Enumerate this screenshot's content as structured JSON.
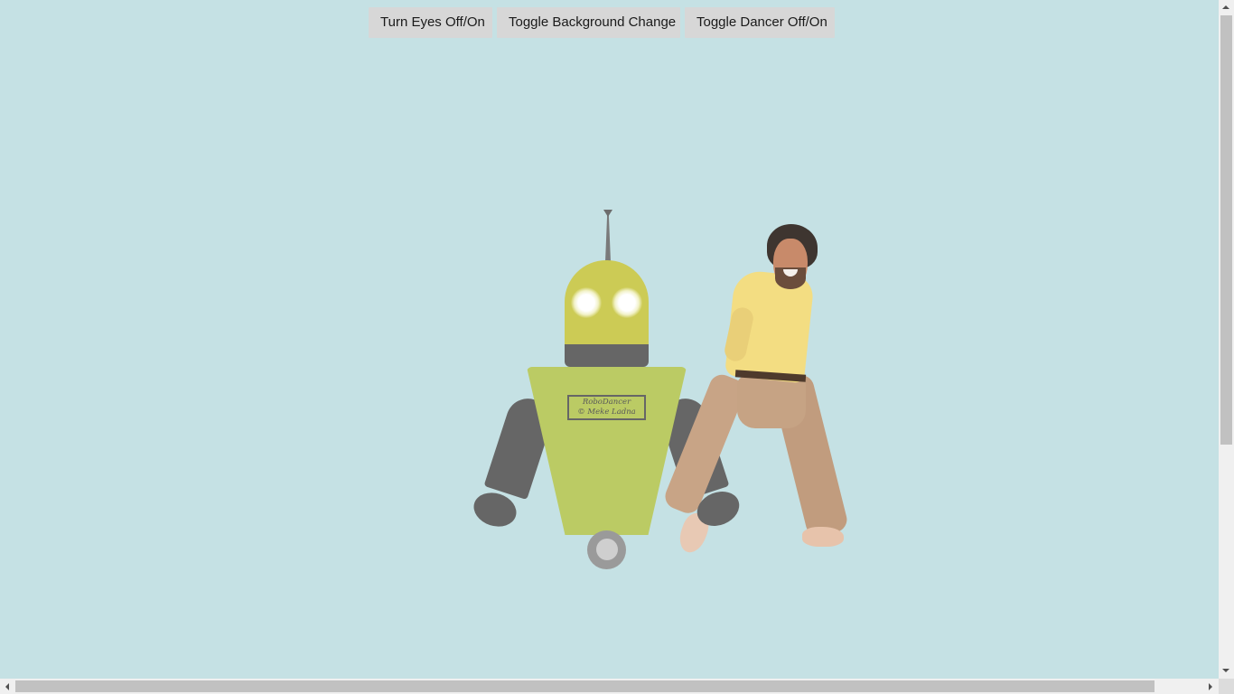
{
  "toolbar": {
    "eyes_label": "Turn Eyes Off/On",
    "background_label": "Toggle Background Change",
    "dancer_label": "Toggle Dancer Off/On"
  },
  "robot": {
    "nameplate_line1": "RoboDancer",
    "nameplate_line2": "© Meke Ladna"
  },
  "colors": {
    "background": "#c5e1e4",
    "robot_head": "#cccb55",
    "robot_body": "#bbcb64",
    "robot_limbs": "#666666",
    "button_bg": "#d7d7d7"
  },
  "icons": {
    "scroll_up": "arrow-up-icon",
    "scroll_down": "arrow-down-icon",
    "scroll_left": "arrow-left-icon",
    "scroll_right": "arrow-right-icon"
  }
}
